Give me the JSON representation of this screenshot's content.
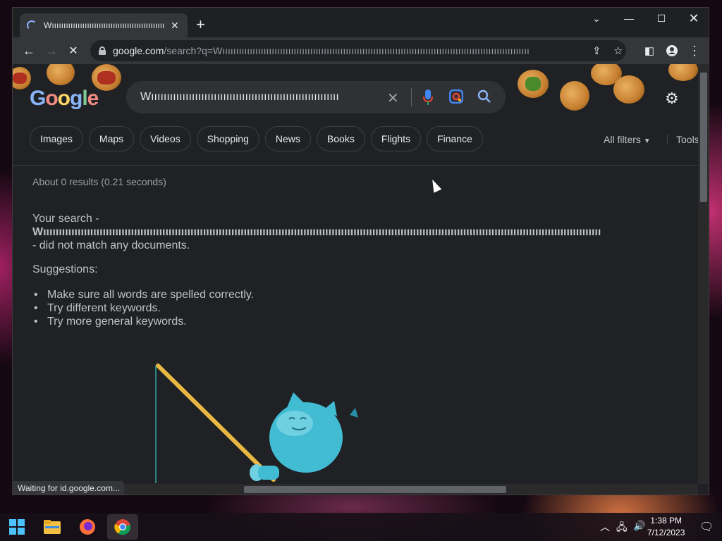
{
  "browser": {
    "tab_title": "Wıııııııııııııııııııııııııııııııııııııııııııııııııııı",
    "omnibox": {
      "host": "google.com",
      "path": "/search?q=Wıııııııııııııııııııııııııııııııııııııııııııııııııııııııııııııııııııııııııııııııııııııııııııııııııııııııııııııııı"
    },
    "status_text": "Waiting for id.google.com..."
  },
  "google": {
    "logo": "Google",
    "search_value": "Wıııııııııııııııııııııııııııııııııııııııııııııııııııııııııııı",
    "chips": [
      "Images",
      "Maps",
      "Videos",
      "Shopping",
      "News",
      "Books",
      "Flights",
      "Finance"
    ],
    "all_filters": "All filters",
    "tools": "Tools",
    "stats": "About 0 results (0.21 seconds)",
    "no_result_prefix": "Your search -",
    "no_result_query": "Wıııııııııııııııııııııııııııııııııııııııııııııııııııııııııııııııııııııııııııııııııııııııııııııııııııııııııııııııııııııııııııııııııııııııııııııııııııııııııııııııııııııııııııııııııı",
    "no_result_suffix": "- did not match any documents.",
    "suggestions_label": "Suggestions:",
    "suggestions": [
      "Make sure all words are spelled correctly.",
      "Try different keywords.",
      "Try more general keywords."
    ]
  },
  "taskbar": {
    "time": "1:38 PM",
    "date": "7/12/2023"
  },
  "colors": {
    "page_bg": "#202124",
    "chip_border": "#3c4043",
    "mic_blue": "#4285f4"
  }
}
